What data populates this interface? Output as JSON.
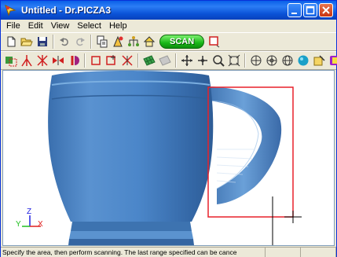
{
  "window": {
    "title": "Untitled - Dr.PICZA3"
  },
  "menu": [
    "File",
    "Edit",
    "View",
    "Select",
    "Help"
  ],
  "toolbar1": {
    "icons": [
      "new-file-icon",
      "open-folder-icon",
      "save-icon",
      "undo-icon",
      "redo-icon",
      "print-setup-icon",
      "scan-settings-icon",
      "tree-icon",
      "house-icon"
    ],
    "scan_label": "SCAN",
    "stop_icon": "stop-icon"
  },
  "toolbar2": {
    "icons": [
      "select-area-icon",
      "point-icon",
      "mesh-icon",
      "mirror-icon",
      "flip-icon",
      "crop-icon",
      "crop-plus-icon",
      "grid-icon",
      "texture-icon",
      "surface-icon",
      "move-icon",
      "pan-icon",
      "zoom-icon",
      "fit-icon",
      "rotate-x-icon",
      "rotate-y-icon",
      "rotate-z-icon",
      "shaded-icon",
      "material-icon",
      "color-icon"
    ]
  },
  "viewport": {
    "axis_labels": {
      "x": "X",
      "y": "Y",
      "z": "Z"
    },
    "colors": {
      "model": "#4b86c9",
      "selection": "#e8212a",
      "axis_x": "#e02020",
      "axis_y": "#20c020",
      "axis_z": "#2020e0"
    }
  },
  "status": {
    "text": "Specify the area, then perform scanning. The last range specified can be cance"
  }
}
